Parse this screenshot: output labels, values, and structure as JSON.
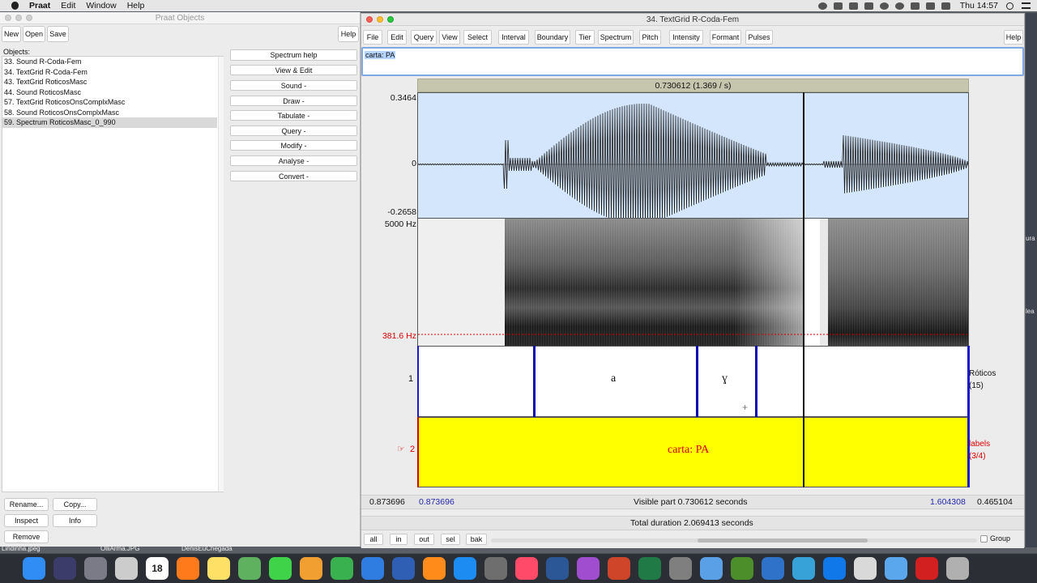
{
  "menubar": {
    "app": "Praat",
    "menus": [
      "Edit",
      "Window",
      "Help"
    ],
    "clock": "Thu 14:57"
  },
  "objects_window": {
    "title": "Praat Objects",
    "buttons": {
      "new": "New",
      "open": "Open",
      "save": "Save",
      "help": "Help"
    },
    "objects_label": "Objects:",
    "objects": [
      "33. Sound R-Coda-Fem",
      "34. TextGrid R-Coda-Fem",
      "43. TextGrid RoticosMasc",
      "44. Sound RoticosMasc",
      "57. TextGrid RoticosOnsComplxMasc",
      "58. Sound RoticosOnsComplxMasc",
      "59. Spectrum RoticosMasc_0_990"
    ],
    "selected_index": 6,
    "dynamic_buttons": [
      "Spectrum help",
      "View & Edit",
      "Sound -",
      "Draw -",
      "Tabulate -",
      "Query -",
      "Modify -",
      "Analyse -",
      "Convert -"
    ],
    "bottom_buttons": {
      "rename": "Rename...",
      "copy": "Copy...",
      "inspect": "Inspect",
      "info": "Info",
      "remove": "Remove"
    }
  },
  "editor_window": {
    "title": "34. TextGrid R-Coda-Fem",
    "menus": [
      "File",
      "Edit",
      "Query",
      "View",
      "Select",
      "Interval",
      "Boundary",
      "Tier",
      "Spectrum",
      "Pitch",
      "Intensity",
      "Formant",
      "Pulses"
    ],
    "help": "Help",
    "text_field": "carta: PA",
    "selection_header": "0.730612 (1.369 / s)",
    "wave_ticks": {
      "max": "0.3464",
      "zero": "0",
      "min": "-0.2658"
    },
    "spectrogram": {
      "top": "5000 Hz",
      "pitch_floor": "381.6 Hz"
    },
    "tiers": [
      {
        "number": "1",
        "name": "Róticos",
        "count": "(15)",
        "labels": [
          "a",
          "ɣ"
        ]
      },
      {
        "number": "2",
        "pointer": "☞",
        "name": "labels",
        "count": "(3/4)",
        "labels": [
          "carta: PA"
        ]
      }
    ],
    "time_row": {
      "left_outside": "0.873696",
      "window_start": "0.873696",
      "visible": "Visible part 0.730612 seconds",
      "window_end": "1.604308",
      "right_outside": "0.465104"
    },
    "total": "Total duration 2.069413 seconds",
    "nav": {
      "all": "all",
      "in": "in",
      "out": "out",
      "sel": "sel",
      "bak": "bak",
      "group": "Group"
    }
  },
  "desktop": {
    "dock_files": [
      "Lindinha.jpeg",
      "DenisEuChegada",
      "OlliArma.JPG"
    ],
    "edge_labels": [
      "ura",
      "lea"
    ]
  },
  "dock": {
    "calendar_day": "18",
    "icons": [
      "finder-icon",
      "siri-icon",
      "launchpad-icon",
      "preview-icon",
      "calendar-icon",
      "firefox-icon",
      "notes-icon",
      "maps-icon",
      "messages-icon",
      "photos-icon",
      "numbers-icon",
      "keynote-icon",
      "r-icon",
      "books-icon",
      "app-store-icon",
      "system-preferences-icon",
      "music-icon",
      "word-icon",
      "praat-icon",
      "powerpoint-icon",
      "excel-icon",
      "tex-icon",
      "family-icon",
      "network-icon",
      "gateway-icon",
      "quicktime-icon",
      "dropbox-icon",
      "documents-icon",
      "folder-icon",
      "acrobat-icon",
      "trash-icon"
    ],
    "colors": {
      "bg": "#2b2f35"
    }
  }
}
